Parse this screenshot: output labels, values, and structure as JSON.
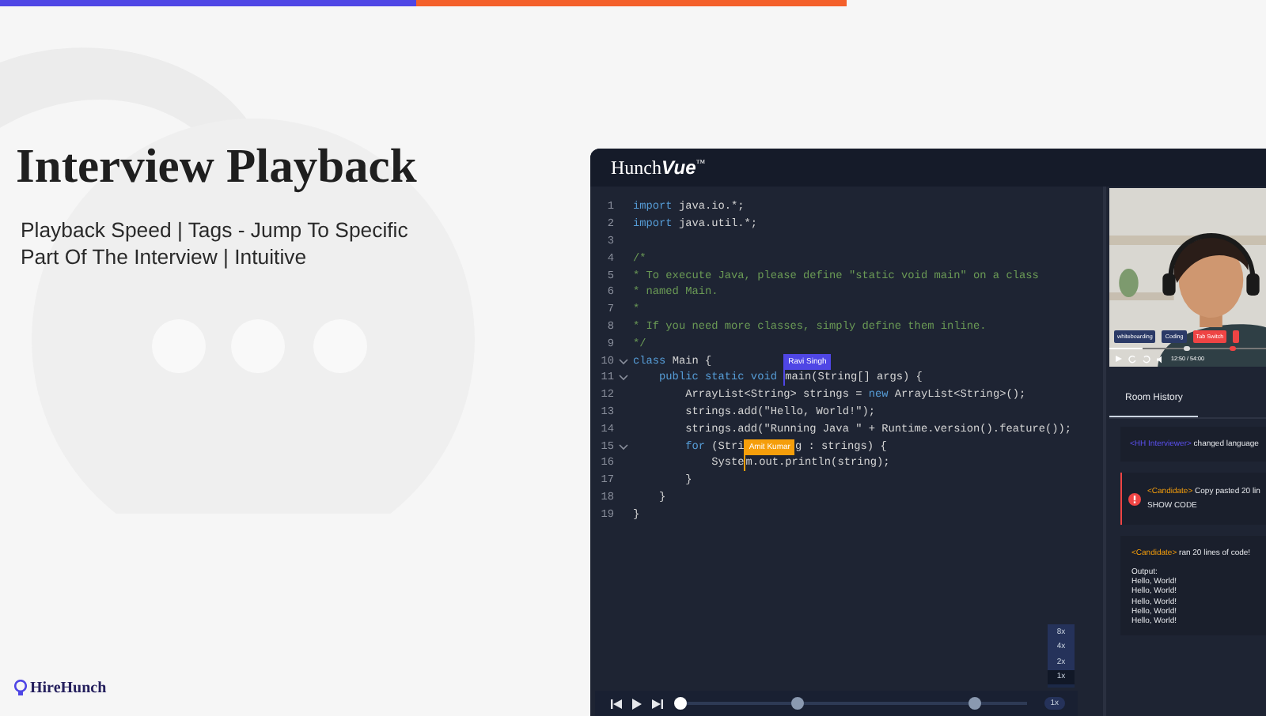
{
  "hero": {
    "title": "Interview Playback",
    "subtitle": "Playback Speed | Tags - Jump To Specific Part Of The Interview | Intuitive"
  },
  "logo": {
    "name": "HireHunch"
  },
  "app": {
    "brand": "Hunch",
    "brand_bold": "Vue",
    "brand_mark": "™"
  },
  "code": {
    "lines": [
      {
        "num": "1",
        "fold": false,
        "segs": [
          {
            "kind": "kw",
            "t": "import"
          },
          {
            "kind": "plain",
            "t": " java.io.*;"
          }
        ]
      },
      {
        "num": "2",
        "fold": false,
        "segs": [
          {
            "kind": "kw",
            "t": "import"
          },
          {
            "kind": "plain",
            "t": " java.util.*;"
          }
        ]
      },
      {
        "num": "3",
        "fold": false
      },
      {
        "num": "4",
        "fold": false,
        "segs": [
          {
            "kind": "comment",
            "t": "/*"
          }
        ]
      },
      {
        "num": "5",
        "fold": false,
        "segs": [
          {
            "kind": "comment",
            "t": "* To execute Java, please define \"static void main\" on a class"
          }
        ]
      },
      {
        "num": "6",
        "fold": false,
        "segs": [
          {
            "kind": "comment",
            "t": "* named Main."
          }
        ]
      },
      {
        "num": "7",
        "fold": false,
        "segs": [
          {
            "kind": "comment",
            "t": "*"
          }
        ]
      },
      {
        "num": "8",
        "fold": false,
        "segs": [
          {
            "kind": "comment",
            "t": "* If you need more classes, simply define them inline."
          }
        ]
      },
      {
        "num": "9",
        "fold": false,
        "segs": [
          {
            "kind": "comment",
            "t": "*/"
          }
        ]
      },
      {
        "num": "10",
        "fold": true,
        "segs": [
          {
            "kind": "kw",
            "t": "class"
          },
          {
            "kind": "plain",
            "t": " Main {"
          }
        ]
      },
      {
        "num": "11",
        "fold": true,
        "segs": [
          {
            "kind": "kw",
            "t": "    public static void "
          },
          {
            "kind": "caret",
            "label": "Ravi Singh",
            "color": "#4f46e5"
          },
          {
            "kind": "plain",
            "t": "main(String[] args) {"
          }
        ]
      },
      {
        "num": "12",
        "fold": false,
        "segs": [
          {
            "kind": "plain",
            "t": "        ArrayList<String> strings = "
          },
          {
            "kind": "kw",
            "t": "new"
          },
          {
            "kind": "plain",
            "t": " ArrayList<String>();"
          }
        ]
      },
      {
        "num": "13",
        "fold": false,
        "segs": [
          {
            "kind": "plain",
            "t": "        strings.add(\"Hello, World!\");"
          }
        ]
      },
      {
        "num": "14",
        "fold": false,
        "segs": [
          {
            "kind": "plain",
            "t": "        strings.add(\"Running Java \" + Runtime.version().feature());"
          }
        ]
      },
      {
        "num": "15",
        "fold": true,
        "segs": [
          {
            "kind": "kw",
            "t": "        for"
          },
          {
            "kind": "plain",
            "t": " (Stri"
          },
          {
            "kind": "tag",
            "label": "Amit Kumar",
            "color": "#f59e0b"
          },
          {
            "kind": "plain",
            "t": "g : strings) {"
          }
        ]
      },
      {
        "num": "16",
        "fold": false,
        "segs": [
          {
            "kind": "plain",
            "t": "            Syste"
          },
          {
            "kind": "caret",
            "color": "#f59e0b"
          },
          {
            "kind": "plain",
            "t": "m.out.println(string);"
          }
        ]
      },
      {
        "num": "17",
        "fold": false,
        "segs": [
          {
            "kind": "plain",
            "t": "        }"
          }
        ]
      },
      {
        "num": "18",
        "fold": false,
        "segs": [
          {
            "kind": "plain",
            "t": "    }"
          }
        ]
      },
      {
        "num": "19",
        "fold": false,
        "segs": [
          {
            "kind": "plain",
            "t": "}"
          }
        ]
      }
    ]
  },
  "speed_menu": [
    {
      "label": "8x",
      "selected": false
    },
    {
      "label": "4x",
      "selected": false
    },
    {
      "label": "2x",
      "selected": false
    },
    {
      "label": "1x",
      "selected": true
    }
  ],
  "player": {
    "level": 0,
    "speed": "1x"
  },
  "video": {
    "level": 0.2,
    "time": "12:50 / 54:00",
    "tags": [
      {
        "label": "whiteboarding",
        "color": "#2b3a67"
      },
      {
        "label": "Coding",
        "color": "#2b3a67"
      },
      {
        "label": "Tab Switch",
        "color": "#ef4444"
      },
      {
        "color": "#ef4444"
      }
    ]
  },
  "tabs": [
    {
      "label": "Room History",
      "selected": true
    }
  ],
  "history": [
    {
      "kind": "info",
      "actor": {
        "kind": "interviewer",
        "text": "<HH Interviewer>"
      },
      "text": " changed language"
    },
    {
      "kind": "alert",
      "actor": {
        "kind": "candidate",
        "text": "<Candidate>"
      },
      "text": " Copy pasted 20 lin",
      "action": "SHOW CODE"
    },
    {
      "kind": "output",
      "actor": {
        "kind": "candidate",
        "text": "<Candidate>"
      },
      "text": " ran 20 lines of  code!",
      "output": [
        "Output:",
        "Hello, World!",
        "Hello, World!",
        "Hello, World!",
        "Hello, World!",
        "Hello, World!"
      ]
    }
  ]
}
